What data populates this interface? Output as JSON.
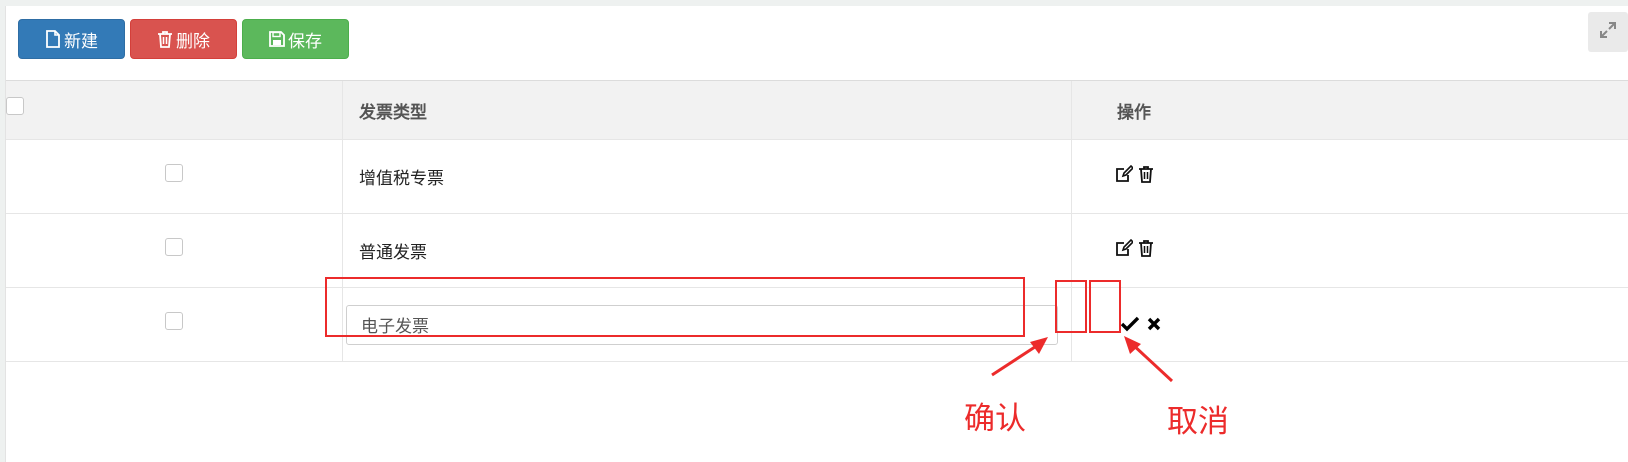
{
  "toolbar": {
    "new_label": "新建",
    "delete_label": "删除",
    "save_label": "保存"
  },
  "table": {
    "headers": {
      "type": "发票类型",
      "ops": "操作"
    },
    "rows": [
      {
        "type": "增值税专票"
      },
      {
        "type": "普通发票"
      }
    ],
    "editing_row": {
      "value": "电子发票"
    }
  },
  "annotations": {
    "confirm_label": "确认",
    "cancel_label": "取消"
  },
  "colors": {
    "primary": "#337ab7",
    "danger": "#d9534f",
    "success": "#5cb85c",
    "annotation": "#ec2b2b"
  }
}
